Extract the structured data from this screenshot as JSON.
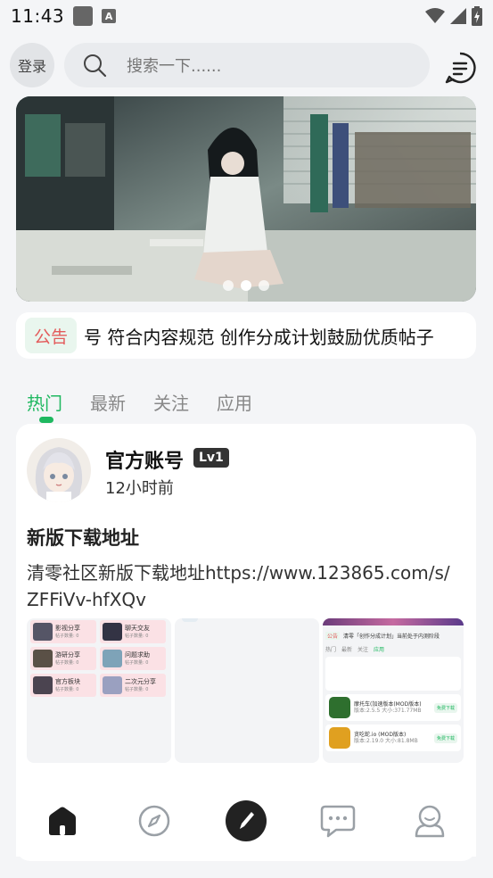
{
  "status": {
    "time": "11:43",
    "notif_icon_letter": "A"
  },
  "header": {
    "login_label": "登录",
    "search_placeholder": "搜索一下......"
  },
  "banner": {
    "dots": 3,
    "active_dot": 1
  },
  "notice": {
    "tag": "公告",
    "text": "号 符合内容规范 创作分成计划鼓励优质帖子"
  },
  "tabs": [
    {
      "label": "热门",
      "active": true
    },
    {
      "label": "最新",
      "active": false
    },
    {
      "label": "关注",
      "active": false
    },
    {
      "label": "应用",
      "active": false
    }
  ],
  "post": {
    "author": "官方账号",
    "level": "Lv1",
    "time": "12小时前",
    "title": "新版下载地址",
    "body": "清零社区新版下载地址https://www.123865.com/s/ZFFiVv-hfXQv",
    "thumb1": {
      "categories": [
        {
          "name": "影视分享",
          "sub": "帖子数量: 0"
        },
        {
          "name": "聊天交友",
          "sub": "帖子数量: 0"
        },
        {
          "name": "游研分享",
          "sub": "帖子数量: 0"
        },
        {
          "name": "问题求助",
          "sub": "帖子数量: 0"
        },
        {
          "name": "官方板块",
          "sub": "帖子数量: 0"
        },
        {
          "name": "二次元分享",
          "sub": "帖子数量: 0"
        }
      ]
    },
    "thumb3": {
      "notice_tag": "公告",
      "notice_text": "清零「创作分成计划」当前处于内测阶段",
      "tabs": [
        "热门",
        "最新",
        "关注",
        "应用"
      ],
      "active_tab": "应用",
      "apps": [
        {
          "name": "摩托车(加速版本(MOD版本)",
          "meta": "版本:2.5.5 大小:371.77MB",
          "btn": "免费下载"
        },
        {
          "name": "贪吃蛇.io (MOD版本)",
          "meta": "版本:2.19.0 大小:81.8MB",
          "btn": "免费下载"
        }
      ]
    }
  },
  "colors": {
    "accent": "#1fb860",
    "notice_red": "#e35b5b",
    "bg": "#f4f5f7"
  },
  "bottom_nav": [
    "home-icon",
    "compass-icon",
    "edit-icon",
    "message-icon",
    "profile-icon"
  ]
}
